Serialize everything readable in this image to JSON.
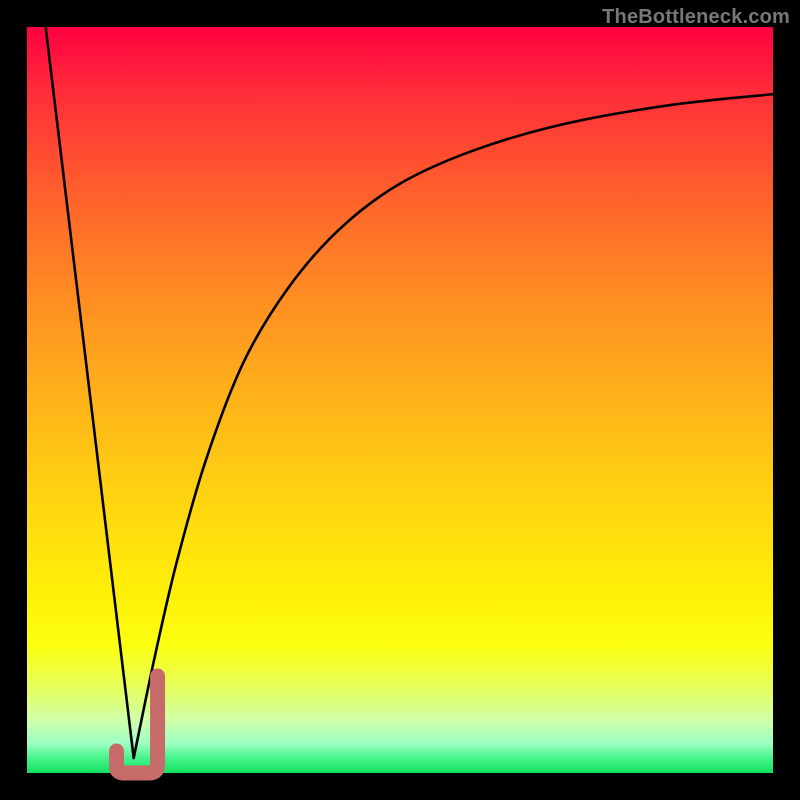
{
  "watermark": "TheBottleneck.com",
  "colors": {
    "frame": "#000000",
    "gradient_top": "#ff0040",
    "gradient_bottom": "#12e060",
    "curve_stroke": "#000000",
    "dip_marker": "#c76a6a"
  },
  "chart_data": {
    "type": "line",
    "title": "",
    "xlabel": "",
    "ylabel": "",
    "xlim": [
      0,
      100
    ],
    "ylim": [
      0,
      100
    ],
    "grid": false,
    "legend": false,
    "series": [
      {
        "name": "left-slope",
        "x": [
          2.5,
          14.3
        ],
        "y": [
          100,
          2
        ]
      },
      {
        "name": "right-curve",
        "x": [
          14.3,
          17,
          20,
          24,
          29,
          35,
          42,
          50,
          60,
          72,
          86,
          100
        ],
        "y": [
          2,
          15,
          28,
          42,
          55,
          65,
          73,
          79,
          83.5,
          87,
          89.5,
          91
        ]
      }
    ],
    "annotations": [
      {
        "name": "dip-marker-J",
        "approx_x_range": [
          12,
          17.5
        ],
        "approx_y_range": [
          0,
          13
        ],
        "color": "#c76a6a"
      }
    ]
  }
}
